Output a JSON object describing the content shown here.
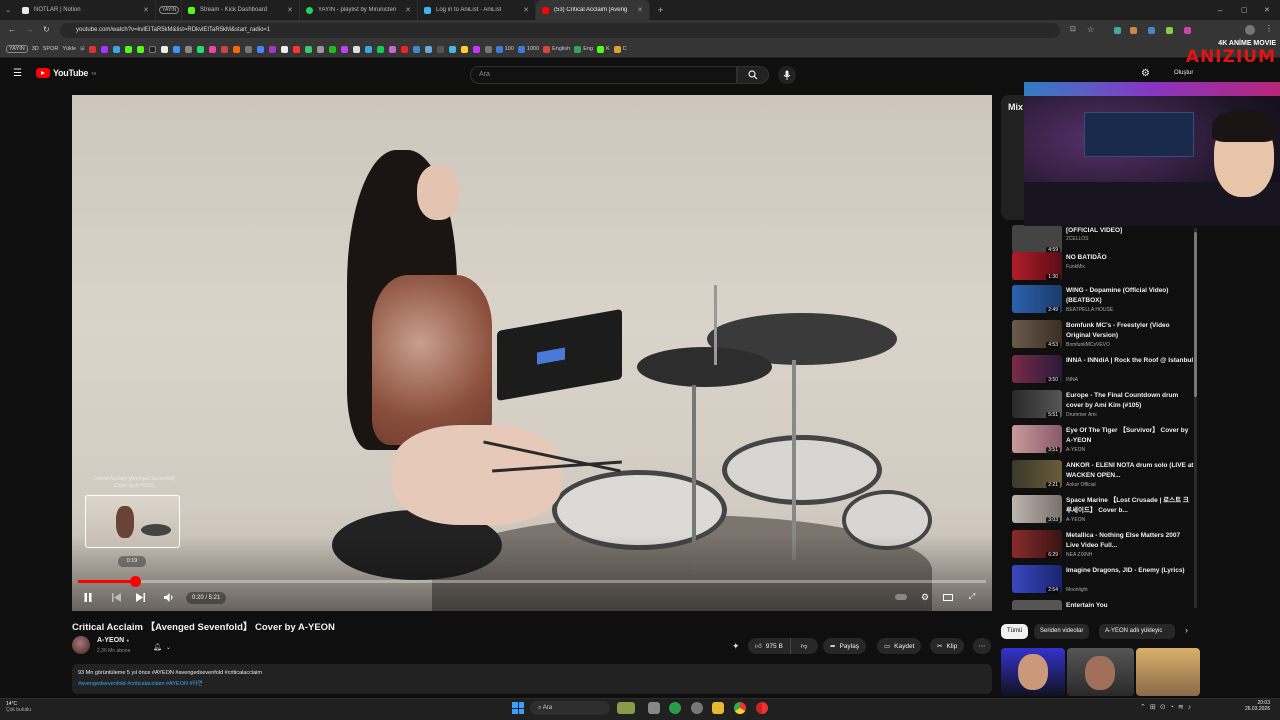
{
  "browser": {
    "tabs": [
      {
        "label": "NOTLAR | Notion",
        "color": "#e8e8e8",
        "active": false
      },
      {
        "label": "YAYIN",
        "color": "#666",
        "active": false
      },
      {
        "label": "Stream - Kick Dashboard",
        "color": "#53fc18",
        "active": false
      },
      {
        "label": "YAYIN - playlist by Mirunicteri",
        "color": "#1ed760",
        "active": false
      },
      {
        "label": "Log in to AniList · AniList",
        "color": "#3db4f2",
        "active": false
      },
      {
        "label": "(53) Critical Acclaim [Aveng",
        "color": "#ff0000",
        "active": true
      }
    ],
    "url": "youtube.com/watch?v=kvlEITaR5kM&list=RDkvlEITaR5kM&start_radio=1",
    "bookmarks": [
      {
        "label": "YAYIN",
        "color": "#777"
      },
      {
        "label": "3D",
        "color": "#777"
      },
      {
        "label": "SPOR",
        "color": "#777"
      },
      {
        "label": "Yükle",
        "color": "#777"
      },
      {
        "label": "100",
        "color": "#3d7bd9"
      },
      {
        "label": "1000",
        "color": "#3d7bd9"
      },
      {
        "label": "English",
        "color": "#d9443d"
      },
      {
        "label": "Eng",
        "color": "#2fa84f"
      },
      {
        "label": "K",
        "color": "#53fc18"
      },
      {
        "label": "C",
        "color": "#e0a030"
      }
    ]
  },
  "youtube": {
    "logo_text": "YouTube",
    "logo_sup": "TR",
    "search_placeholder": "Ara",
    "create_label": "Oluştur"
  },
  "player": {
    "current_time": "0:20 / 5:21",
    "progress": 0.063,
    "preview_time": "0:19",
    "preview_title": "Critical Acclaim [Avenged Sevenfold] Cover by A-YEON"
  },
  "video": {
    "title": "Critical Acclaim 【Avenged Sevenfold】 Cover by A-YEON",
    "channel": "A-YEON",
    "subscribers": "2,36 Mn abone",
    "likes": "975 B",
    "share_label": "Paylaş",
    "save_label": "Kaydet",
    "clip_label": "Klip",
    "views_line": "93 Mn görüntüleme  5 yıl önce  #AYEON #avengedsevenfold #criticalacclaim",
    "tags_line": "#avengedsevenfold #criticalacclaim #AYEON #아연"
  },
  "overlay": {
    "brand_line1": "4K ANİME MOVIE",
    "brand_line2": "ANIZIUM"
  },
  "sidebar": {
    "mix_label": "Mix",
    "items": [
      {
        "title": "[OFFICIAL VIDEO]",
        "channel": "2CELLOS",
        "duration": "4:59",
        "color": "#444"
      },
      {
        "title": "NO BATIDÃO",
        "channel": "FunkMix",
        "duration": "1:30",
        "color": "#b01d2a"
      },
      {
        "title": "WING - Dopamine (Official Video) (BEATBOX)",
        "channel": "BEATPELLA HOUSE",
        "duration": "2:49",
        "color": "#2b62b0"
      },
      {
        "title": "Bomfunk MC's - Freestyler (Video Original Version)",
        "channel": "BomfunkMCsVEVO",
        "duration": "4:53",
        "color": "#6a5a4a"
      },
      {
        "title": "INNA - INNdiA | Rock the Roof @ Istanbul",
        "channel": "INNA",
        "duration": "3:50",
        "color": "#7a2a4a"
      },
      {
        "title": "Europe - The Final Countdown drum cover by Ami Kim (#105)",
        "channel": "Drummer Ami",
        "duration": "5:51",
        "color": "#2a2a2a"
      },
      {
        "title": "Eye Of The Tiger 【Survivor】 Cover by A-YEON",
        "channel": "A-YEON",
        "duration": "3:51",
        "color": "#c89a9a"
      },
      {
        "title": "ANKOR - ELENI NOTA drum solo (LIVE at WACKEN OPEN...",
        "channel": "Ankor Official",
        "duration": "2:21",
        "color": "#3a3a2a"
      },
      {
        "title": "Space Marine 【Lost Crusade | 로스트 크루세이드】 Cover b...",
        "channel": "A-YEON",
        "duration": "3:03",
        "color": "#bdb5b0"
      },
      {
        "title": "Metallica - Nothing Else Matters 2007 Live Video Full...",
        "channel": "NEA ZIXNH",
        "duration": "6:29",
        "color": "#8a2a2a"
      },
      {
        "title": "Imagine Dragons, JID - Enemy (Lyrics)",
        "channel": "Moonlight",
        "duration": "2:54",
        "color": "#3a48c0"
      },
      {
        "title": "Entertain You",
        "channel": "",
        "duration": "",
        "color": "#555"
      }
    ],
    "chips": [
      "Tümü",
      "Seriden videolar",
      "A-YEON adlı yükleyic"
    ]
  },
  "taskbar": {
    "weather_temp": "14°C",
    "weather_desc": "Çok bulutlu",
    "search_label": "Ara",
    "time": "20:03",
    "date": "26.03.2026"
  }
}
